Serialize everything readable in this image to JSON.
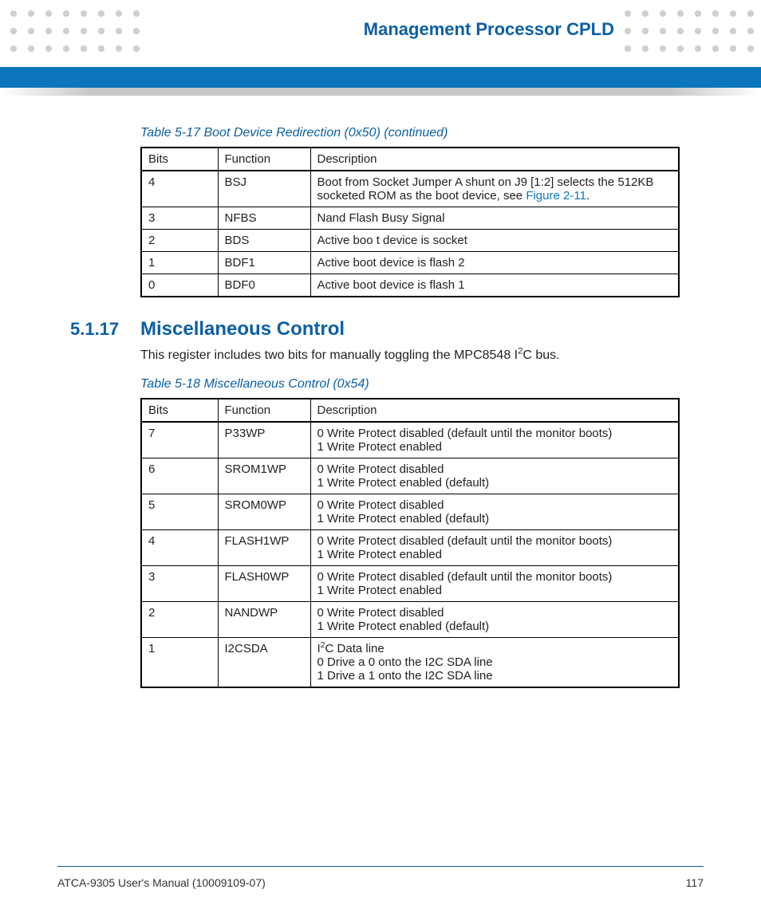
{
  "header": {
    "title": "Management Processor CPLD"
  },
  "table17": {
    "caption": "Table 5-17 Boot Device Redirection (0x50) (continued)",
    "cols": [
      "Bits",
      "Function",
      "Description"
    ],
    "rows": [
      {
        "bits": "4",
        "func": "BSJ",
        "desc": [
          "Boot from Socket Jumper A shunt on J9 [1:2] selects the 512KB socketed ROM as the boot device, see "
        ],
        "link": "Figure 2-11",
        "tail": "."
      },
      {
        "bits": "3",
        "func": "NFBS",
        "desc": [
          "Nand Flash Busy Signal"
        ]
      },
      {
        "bits": "2",
        "func": "BDS",
        "desc": [
          "Active boo t device is socket"
        ]
      },
      {
        "bits": "1",
        "func": "BDF1",
        "desc": [
          "Active boot device is flash 2"
        ]
      },
      {
        "bits": "0",
        "func": "BDF0",
        "desc": [
          "Active boot device is flash 1"
        ]
      }
    ]
  },
  "section": {
    "num": "5.1.17",
    "title": "Miscellaneous Control",
    "body_pre": "This register includes two bits for manually toggling the MPC8548 I",
    "body_post": "C bus."
  },
  "table18": {
    "caption": "Table 5-18 Miscellaneous Control (0x54)",
    "cols": [
      "Bits",
      "Function",
      "Description"
    ],
    "rows": [
      {
        "bits": "7",
        "func": "P33WP",
        "desc": [
          "0 Write Protect disabled (default until the monitor boots)",
          "1 Write Protect enabled"
        ]
      },
      {
        "bits": "6",
        "func": "SROM1WP",
        "desc": [
          "0 Write Protect disabled",
          "1 Write Protect enabled (default)"
        ]
      },
      {
        "bits": "5",
        "func": "SROM0WP",
        "desc": [
          "0 Write Protect disabled",
          "1 Write Protect enabled (default)"
        ]
      },
      {
        "bits": "4",
        "func": "FLASH1WP",
        "desc": [
          "0 Write Protect disabled (default until the monitor boots)",
          "1 Write Protect enabled"
        ]
      },
      {
        "bits": "3",
        "func": "FLASH0WP",
        "desc": [
          "0 Write Protect disabled (default until the monitor boots)",
          "1 Write Protect enabled"
        ]
      },
      {
        "bits": "2",
        "func": "NANDWP",
        "desc": [
          "0 Write Protect disabled",
          "1 Write Protect enabled (default)"
        ]
      },
      {
        "bits": "1",
        "func": "I2CSDA",
        "i2c": true,
        "desc": [
          "0 Drive a 0 onto the I2C SDA line",
          "1 Drive a 1 onto the I2C SDA line"
        ]
      }
    ]
  },
  "footer": {
    "left": "ATCA-9305 User's Manual (10009109-07)",
    "right": "117"
  }
}
